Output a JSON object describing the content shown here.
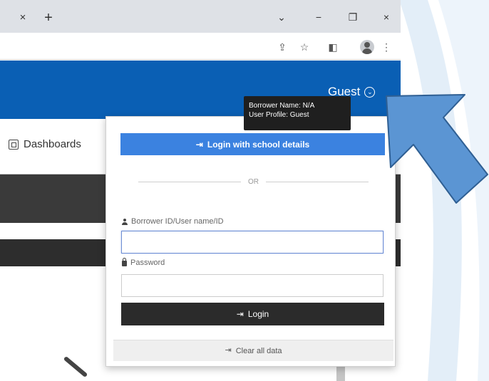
{
  "browser": {
    "tab_close": "×",
    "new_tab": "+",
    "controls": {
      "dropdown": "⌄",
      "minimize": "−",
      "restore": "❐",
      "close": "×"
    },
    "toolbar_icons": {
      "share": "⇪",
      "bookmark": "☆",
      "sidepanel": "◧",
      "menu": "⋮"
    }
  },
  "header": {
    "user_label": "Guest",
    "user_chevron": "⌄"
  },
  "tooltip": {
    "borrower_name": "Borrower Name: N/A",
    "user_profile": "User Profile: Guest"
  },
  "nav": {
    "dashboards_label": "Dashboards"
  },
  "login": {
    "school_button_label": "Login with school details",
    "school_button_icon": "⇥",
    "separator_text": "OR",
    "username_label": "Borrower ID/User name/ID",
    "username_value": "",
    "password_label": "Password",
    "password_value": "",
    "login_button_label": "Login",
    "login_button_icon": "⇥",
    "clear_label": "Clear all data",
    "clear_icon": "⇥"
  },
  "colors": {
    "header_blue": "#0a5fb4",
    "school_button": "#3b82e0",
    "login_button": "#2b2b2b",
    "arrow_fill": "#5b95d3",
    "arrow_stroke": "#2f5f93"
  }
}
